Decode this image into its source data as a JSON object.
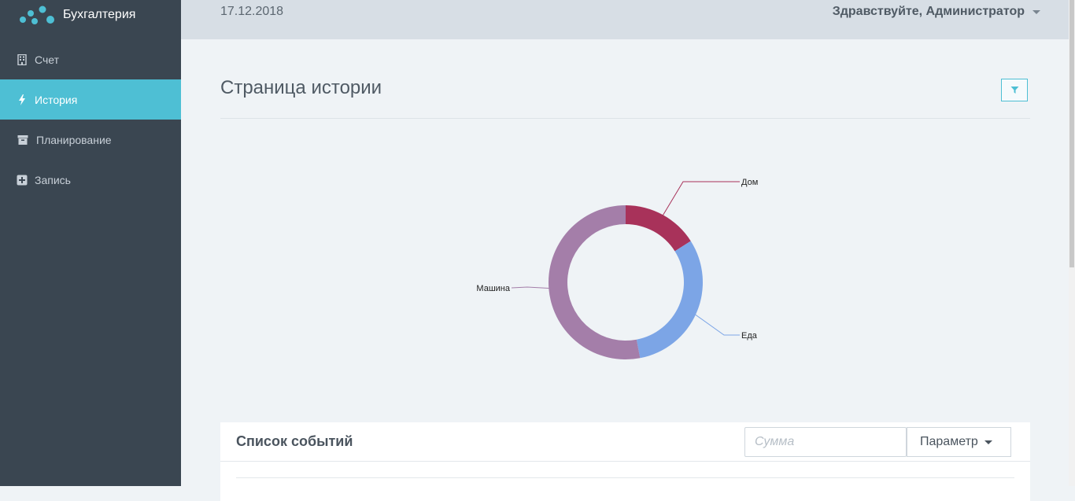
{
  "app": {
    "name": "Бухгалтерия"
  },
  "sidebar": {
    "items": [
      {
        "label": "Счет",
        "icon": "building-icon",
        "active": false
      },
      {
        "label": "История",
        "icon": "bolt-icon",
        "active": true
      },
      {
        "label": "Планирование",
        "icon": "archive-icon",
        "active": false
      },
      {
        "label": "Запись",
        "icon": "plus-square-icon",
        "active": false
      }
    ]
  },
  "header": {
    "date": "17.12.2018",
    "greeting": "Здравствуйте, Администратор"
  },
  "page": {
    "title": "Страница истории",
    "filter_icon": "filter-icon"
  },
  "chart_data": {
    "type": "pie",
    "variant": "donut",
    "title": "",
    "labels": [
      "Дом",
      "Еда",
      "Машина"
    ],
    "values": [
      16,
      31,
      53
    ],
    "colors": [
      "#a8325a",
      "#7ca5e6",
      "#a47ea9"
    ]
  },
  "events": {
    "title": "Список событий",
    "sum_placeholder": "Сумма",
    "param_label": "Параметр"
  },
  "colors": {
    "sidebar_bg": "#3a4651",
    "accent": "#4ebfd4",
    "topbar_bg": "#d7dee5",
    "content_bg": "#eff3f6"
  }
}
